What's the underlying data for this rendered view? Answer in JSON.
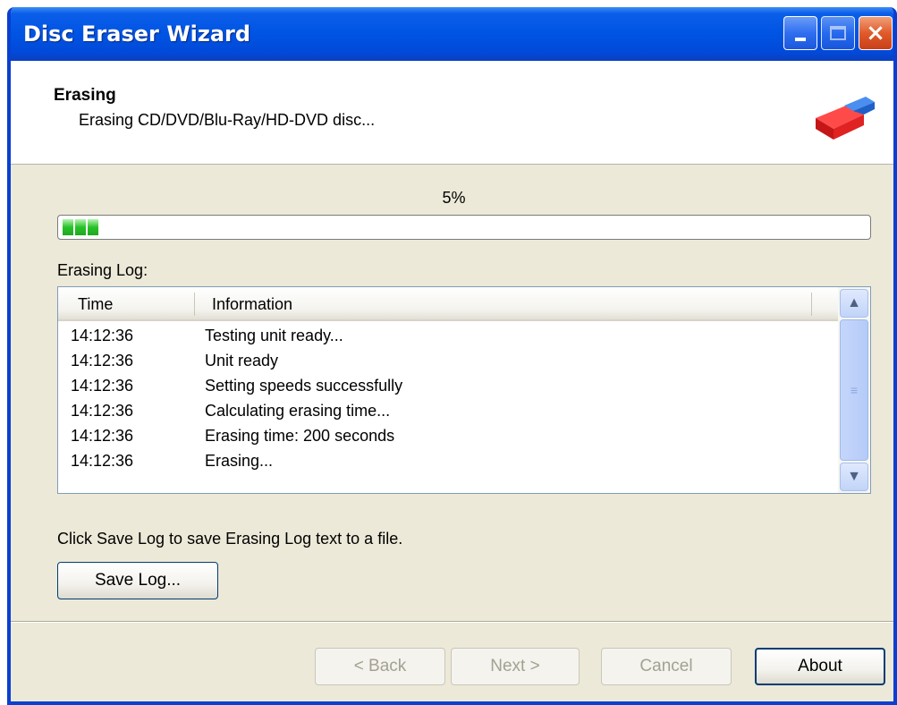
{
  "window": {
    "title": "Disc Eraser Wizard",
    "controls": [
      "minimize-icon",
      "maximize-icon",
      "close-icon"
    ]
  },
  "header": {
    "title": "Erasing",
    "subtitle": "Erasing CD/DVD/Blu-Ray/HD-DVD disc...",
    "icon": "eraser-icon"
  },
  "progress": {
    "percent_label": "5%",
    "value_percent": 5,
    "fill_color": "#29c12a"
  },
  "log": {
    "label": "Erasing Log:",
    "columns": [
      "Time",
      "Information"
    ],
    "rows": [
      {
        "time": "14:12:36",
        "info": "Testing unit ready..."
      },
      {
        "time": "14:12:36",
        "info": "Unit ready"
      },
      {
        "time": "14:12:36",
        "info": "Setting speeds successfully"
      },
      {
        "time": "14:12:36",
        "info": "Calculating erasing time..."
      },
      {
        "time": "14:12:36",
        "info": "Erasing time: 200 seconds"
      },
      {
        "time": "14:12:36",
        "info": "Erasing..."
      }
    ]
  },
  "hint": "Click Save Log to save Erasing Log text to a file.",
  "buttons": {
    "save_log": "Save Log...",
    "back": "< Back",
    "next": "Next >",
    "cancel": "Cancel",
    "about": "About"
  },
  "colors": {
    "titlebar": "#0054e3",
    "dialog_bg": "#ece9d8",
    "progress": "#29c12a"
  }
}
